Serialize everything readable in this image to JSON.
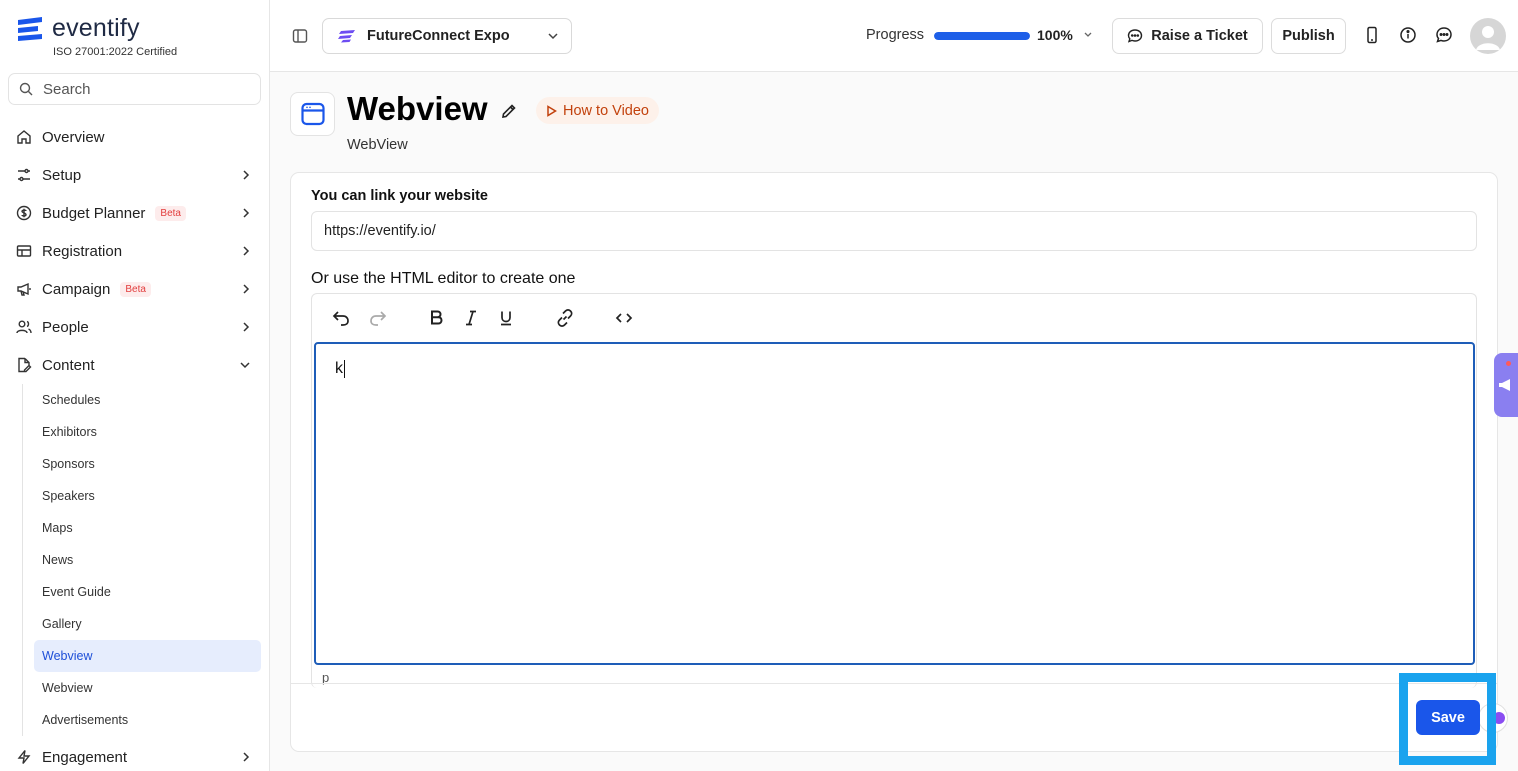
{
  "brand": {
    "name": "eventify",
    "certification": "ISO 27001:2022 Certified"
  },
  "search": {
    "placeholder": "Search"
  },
  "nav": {
    "items": [
      {
        "label": "Overview",
        "icon": "home-icon"
      },
      {
        "label": "Setup",
        "icon": "sliders-icon"
      },
      {
        "label": "Budget Planner",
        "icon": "dollar-circle-icon",
        "badge": "Beta"
      },
      {
        "label": "Registration",
        "icon": "table-icon"
      },
      {
        "label": "Campaign",
        "icon": "megaphone-icon",
        "badge": "Beta"
      },
      {
        "label": "People",
        "icon": "users-icon"
      },
      {
        "label": "Content",
        "icon": "file-edit-icon"
      }
    ],
    "content_sub": [
      "Schedules",
      "Exhibitors",
      "Sponsors",
      "Speakers",
      "Maps",
      "News",
      "Event Guide",
      "Gallery",
      "Webview",
      "Webview",
      "Advertisements"
    ],
    "active_sub_index": 8,
    "engagement": {
      "label": "Engagement",
      "icon": "bolt-icon"
    }
  },
  "topbar": {
    "event_name": "FutureConnect Expo",
    "progress_label": "Progress",
    "progress_value": "100%",
    "progress_fraction": 1.0,
    "raise_ticket": "Raise a Ticket",
    "publish": "Publish"
  },
  "page": {
    "title": "Webview",
    "subtitle": "WebView",
    "how_to": "How to Video"
  },
  "form": {
    "website_label": "You can link your website",
    "website_value": "https://eventify.io/",
    "editor_label": "Or use the HTML editor to create one",
    "editor_content": "k",
    "editor_status": "p",
    "save": "Save"
  },
  "colors": {
    "accent": "#1a56ea",
    "active_bg": "#e6edfd",
    "beta": "#e23d3d",
    "how_to": "#c2410c",
    "highlight": "#1aa3ee"
  }
}
